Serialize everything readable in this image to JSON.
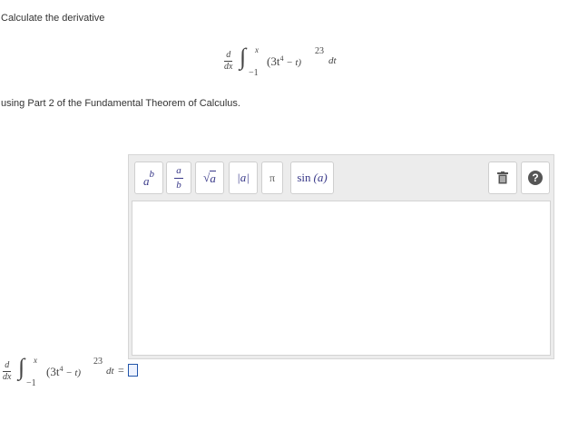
{
  "prompt": {
    "line1": "Calculate the derivative",
    "line2": "using Part 2 of the Fundamental Theorem of Calculus."
  },
  "expression": {
    "d": "d",
    "dx": "dx",
    "integral": "∫",
    "upper": "x",
    "lower": "−1",
    "integrand": "(3t",
    "power4": "4",
    "minus_t": " − t)",
    "exponent": "23",
    "dt": "dt",
    "equals": "="
  },
  "toolbar": {
    "superscript": {
      "base": "a",
      "sup": "b"
    },
    "fraction": {
      "num": "a",
      "den": "b"
    },
    "sqrt": {
      "symbol": "√",
      "arg": "a"
    },
    "abs": "|a|",
    "pi": "π",
    "sin": {
      "fn": "sin",
      "arg": "(a)"
    },
    "trash_icon": "trash-icon",
    "help": "?"
  }
}
